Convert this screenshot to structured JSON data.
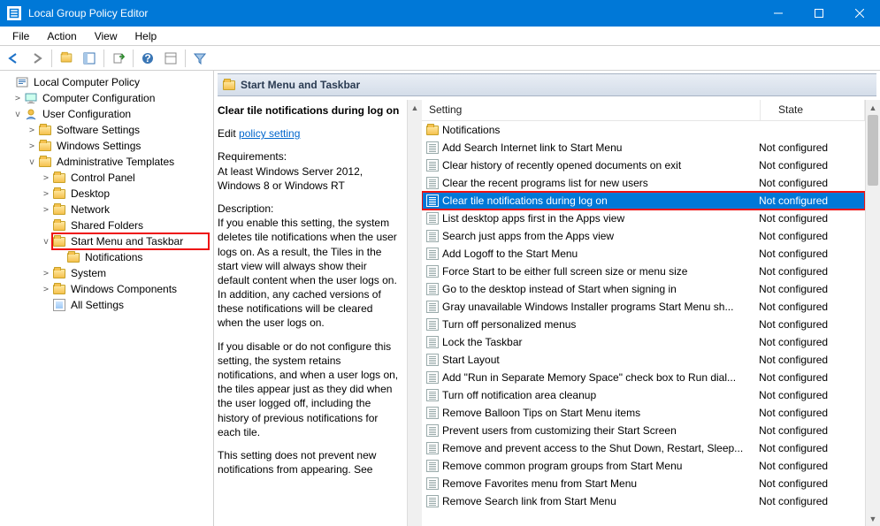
{
  "window": {
    "title": "Local Group Policy Editor"
  },
  "menu": [
    "File",
    "Action",
    "View",
    "Help"
  ],
  "toolbar": {
    "back": "back-icon",
    "forward": "forward-icon",
    "up": "up-icon",
    "props": "properties-icon",
    "refresh": "refresh-icon",
    "export": "export-icon",
    "help": "help-icon",
    "extra1": "options-icon",
    "filter": "filter-icon"
  },
  "tree": {
    "root": "Local Computer Policy",
    "computer": "Computer Configuration",
    "user": "User Configuration",
    "software": "Software Settings",
    "windows": "Windows Settings",
    "admin": "Administrative Templates",
    "controlpanel": "Control Panel",
    "desktop": "Desktop",
    "network": "Network",
    "shared": "Shared Folders",
    "startmenu": "Start Menu and Taskbar",
    "notifications": "Notifications",
    "system": "System",
    "wincomp": "Windows Components",
    "allsettings": "All Settings"
  },
  "content": {
    "header": "Start Menu and Taskbar",
    "selected_title": "Clear tile notifications during log on",
    "edit_prefix": "Edit ",
    "edit_link": "policy setting",
    "req_head": "Requirements:",
    "req_body": "At least Windows Server 2012, Windows 8 or Windows RT",
    "desc_head": "Description:",
    "desc_1": "If you enable this setting, the system deletes tile notifications when the user logs on. As a result, the Tiles in the start view will always show their default content when the user logs on. In addition, any cached versions of these notifications will be cleared when the user logs on.",
    "desc_2": "If you disable or do not configure this setting, the system retains notifications, and when a user logs on, the tiles appear just as they did when the user logged off, including the history of previous notifications for each tile.",
    "desc_3": "This setting does not prevent new notifications from appearing. See"
  },
  "list": {
    "col_setting": "Setting",
    "col_state": "State",
    "rows": [
      {
        "type": "folder",
        "label": "Notifications",
        "state": ""
      },
      {
        "type": "setting",
        "label": "Add Search Internet link to Start Menu",
        "state": "Not configured"
      },
      {
        "type": "setting",
        "label": "Clear history of recently opened documents on exit",
        "state": "Not configured"
      },
      {
        "type": "setting",
        "label": "Clear the recent programs list for new users",
        "state": "Not configured"
      },
      {
        "type": "setting",
        "label": "Clear tile notifications during log on",
        "state": "Not configured",
        "selected": true
      },
      {
        "type": "setting",
        "label": "List desktop apps first in the Apps view",
        "state": "Not configured"
      },
      {
        "type": "setting",
        "label": "Search just apps from the Apps view",
        "state": "Not configured"
      },
      {
        "type": "setting",
        "label": "Add Logoff to the Start Menu",
        "state": "Not configured"
      },
      {
        "type": "setting",
        "label": "Force Start to be either full screen size or menu size",
        "state": "Not configured"
      },
      {
        "type": "setting",
        "label": "Go to the desktop instead of Start when signing in",
        "state": "Not configured"
      },
      {
        "type": "setting",
        "label": "Gray unavailable Windows Installer programs Start Menu sh...",
        "state": "Not configured"
      },
      {
        "type": "setting",
        "label": "Turn off personalized menus",
        "state": "Not configured"
      },
      {
        "type": "setting",
        "label": "Lock the Taskbar",
        "state": "Not configured"
      },
      {
        "type": "setting",
        "label": "Start Layout",
        "state": "Not configured"
      },
      {
        "type": "setting",
        "label": "Add \"Run in Separate Memory Space\" check box to Run dial...",
        "state": "Not configured"
      },
      {
        "type": "setting",
        "label": "Turn off notification area cleanup",
        "state": "Not configured"
      },
      {
        "type": "setting",
        "label": "Remove Balloon Tips on Start Menu items",
        "state": "Not configured"
      },
      {
        "type": "setting",
        "label": "Prevent users from customizing their Start Screen",
        "state": "Not configured"
      },
      {
        "type": "setting",
        "label": "Remove and prevent access to the Shut Down, Restart, Sleep...",
        "state": "Not configured"
      },
      {
        "type": "setting",
        "label": "Remove common program groups from Start Menu",
        "state": "Not configured"
      },
      {
        "type": "setting",
        "label": "Remove Favorites menu from Start Menu",
        "state": "Not configured"
      },
      {
        "type": "setting",
        "label": "Remove Search link from Start Menu",
        "state": "Not configured"
      }
    ]
  }
}
